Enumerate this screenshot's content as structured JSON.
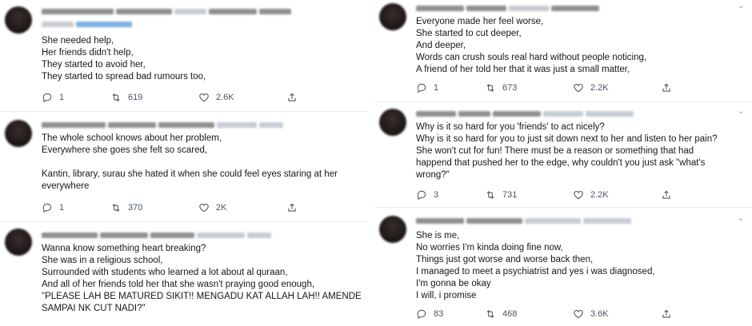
{
  "left": [
    {
      "text": [
        "She needed help,",
        "Her friends didn't help,",
        "They started to avoid her,",
        "They started to spread bad rumours too,"
      ],
      "replies": "1",
      "retweets": "619",
      "likes": "2.6K"
    },
    {
      "text": [
        "The whole school knows about her problem,",
        "Everywhere she goes she felt so scared,",
        "",
        "Kantin, library, surau she hated it when she could feel eyes staring at her",
        "everywhere"
      ],
      "replies": "1",
      "retweets": "370",
      "likes": "2K"
    },
    {
      "text": [
        "Wanna know something heart breaking?",
        "She was in a religious school,",
        "Surrounded with students who learned a lot about al quraan,",
        "And all of her friends told her that she wasn't praying good enough,",
        "\"PLEASE LAH BE MATURED SIKIT!! MENGADU KAT ALLAH LAH!! AMENDE",
        "SAMPAI NK CUT NADI?\""
      ]
    }
  ],
  "right": [
    {
      "text": [
        "Everyone made her feel worse,",
        "She started to cut deeper,",
        "And deeper,",
        "Words can crush souls real hard without people noticing,",
        "A friend of her told her that it was just a small matter,"
      ],
      "replies": "1",
      "retweets": "673",
      "likes": "2.2K"
    },
    {
      "text": [
        "Why is it so hard for you 'friends' to act nicely?",
        "Why is it so hard for you to just sit down next to her and listen to her pain?",
        "She won't cut for fun! There must be a reason or something that had",
        "happend that pushed her to the edge, why couldn't you just ask \"what's",
        "wrong?\""
      ],
      "replies": "3",
      "retweets": "731",
      "likes": "2.2K"
    },
    {
      "text": [
        "She is me,",
        "No worries I'm kinda doing fine now,",
        "Things just got worse and worse back then,",
        "I managed to meet a psychiatrist and yes i was diagnosed,",
        "I'm gonna be okay",
        "I will, i promise"
      ],
      "replies": "83",
      "retweets": "468",
      "likes": "3.6K"
    }
  ],
  "icons": {
    "reply": "reply-icon",
    "retweet": "retweet-icon",
    "like": "heart-icon",
    "share": "share-icon",
    "more": "chevron-down-icon"
  },
  "colors": {
    "text": "#14171a",
    "muted": "#657786",
    "divider": "#e6ecf0"
  }
}
